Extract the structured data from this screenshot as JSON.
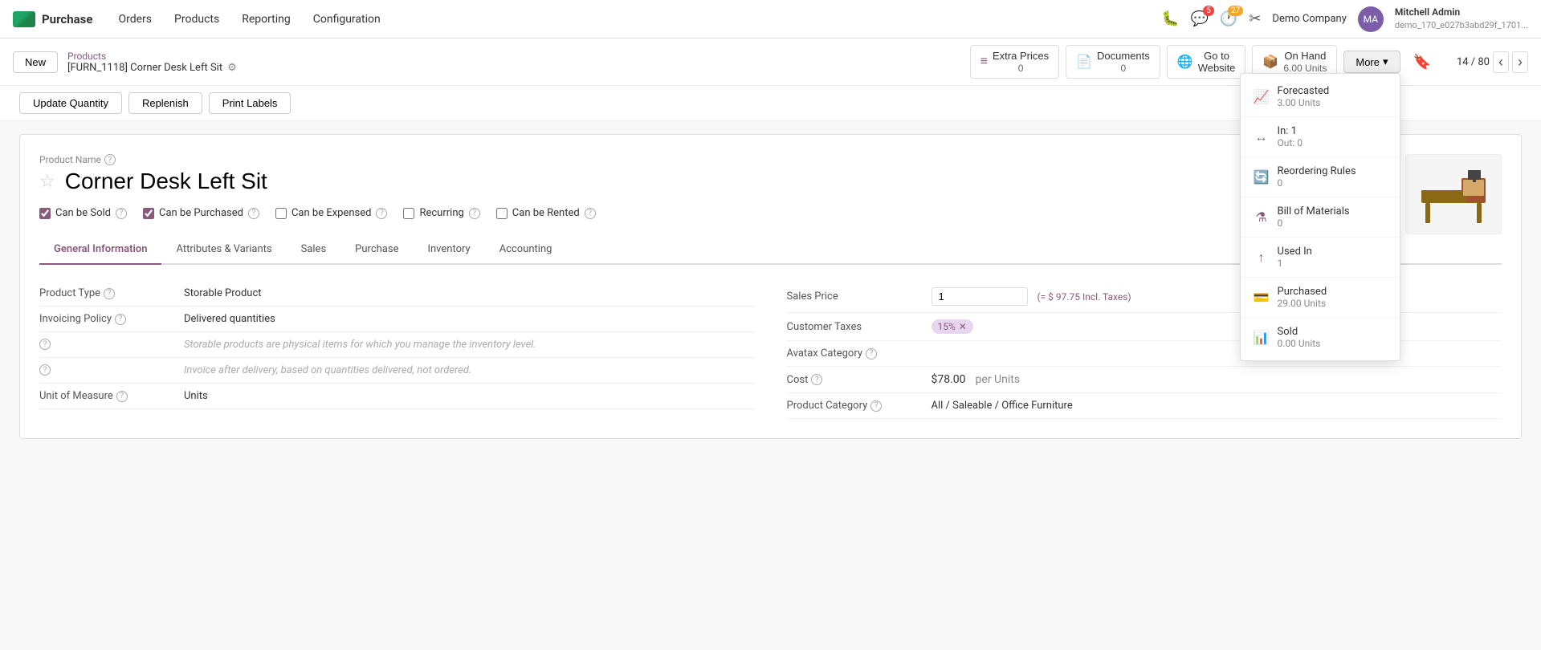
{
  "topnav": {
    "app_name": "Purchase",
    "menu_items": [
      "Orders",
      "Products",
      "Reporting",
      "Configuration"
    ],
    "notifications": [
      {
        "icon": "🐛",
        "count": null
      },
      {
        "icon": "💬",
        "count": "5"
      },
      {
        "icon": "🕐",
        "count": "27"
      }
    ],
    "company": "Demo Company",
    "user": {
      "name": "Mitchell Admin",
      "sub": "demo_170_e027b3abd29f_1701..."
    }
  },
  "actionbar": {
    "new_label": "New",
    "breadcrumb_parent": "Products",
    "breadcrumb_current": "[FURN_1118] Corner Desk Left Sit",
    "actions": [
      {
        "id": "extra-prices",
        "icon": "≡",
        "label": "Extra Prices",
        "count": "0"
      },
      {
        "id": "documents",
        "icon": "📄",
        "label": "Documents",
        "count": "0"
      },
      {
        "id": "go-to-website",
        "icon": "🌐",
        "label": "Go to Website",
        "count": ""
      },
      {
        "id": "on-hand",
        "icon": "📦",
        "label": "On Hand",
        "count": "6.00 Units"
      }
    ],
    "more_label": "More",
    "nav_count": "14 / 80"
  },
  "toolbar": {
    "buttons": [
      "Update Quantity",
      "Replenish",
      "Print Labels"
    ]
  },
  "product": {
    "name_label": "Product Name",
    "name": "Corner Desk Left Sit",
    "can_be_sold": true,
    "can_be_purchased": true,
    "can_be_expensed": false,
    "recurring": false,
    "can_be_rented": false
  },
  "tabs": [
    "General Information",
    "Attributes & Variants",
    "Sales",
    "Purchase",
    "Inventory",
    "Accounting"
  ],
  "active_tab": "General Information",
  "form": {
    "left": [
      {
        "label": "Product Type",
        "help": true,
        "value": "Storable Product",
        "italic": false
      },
      {
        "label": "Invoicing Policy",
        "help": true,
        "value": "Delivered quantities",
        "italic": false
      },
      {
        "label": "",
        "help": true,
        "value": "Storable products are physical items for which you manage the inventory level.",
        "italic": true
      },
      {
        "label": "",
        "help": true,
        "value": "Invoice after delivery, based on quantities delivered, not ordered.",
        "italic": true
      },
      {
        "label": "Unit of Measure",
        "help": true,
        "value": "Units",
        "italic": false
      }
    ],
    "right": [
      {
        "label": "Sales Price",
        "help": false,
        "value": "1",
        "incl_taxes": "(= $ 97.75 Incl. Taxes)"
      },
      {
        "label": "Customer Taxes",
        "help": false,
        "value": "15%",
        "is_tax": true
      },
      {
        "label": "Avatax Category",
        "help": true,
        "value": ""
      },
      {
        "label": "Cost",
        "help": true,
        "value": "$78.00",
        "per_unit": "per Units"
      },
      {
        "label": "Product Category",
        "help": true,
        "value": "All / Saleable / Office Furniture"
      }
    ]
  },
  "dropdown": {
    "items": [
      {
        "id": "forecasted",
        "icon": "📈",
        "label": "Forecasted",
        "sub": "3.00 Units"
      },
      {
        "id": "in-out",
        "icon": "↔",
        "label": "In: 1\nOut: 0",
        "sub": ""
      },
      {
        "id": "reordering-rules",
        "icon": "🔄",
        "label": "Reordering Rules",
        "sub": "0"
      },
      {
        "id": "bill-of-materials",
        "icon": "⚗",
        "label": "Bill of Materials",
        "sub": "0"
      },
      {
        "id": "used-in",
        "icon": "↑",
        "label": "Used In",
        "sub": "1"
      },
      {
        "id": "purchased",
        "icon": "💳",
        "label": "Purchased",
        "sub": "29.00 Units"
      },
      {
        "id": "sold",
        "icon": "📊",
        "label": "Sold",
        "sub": "0.00 Units"
      }
    ]
  }
}
